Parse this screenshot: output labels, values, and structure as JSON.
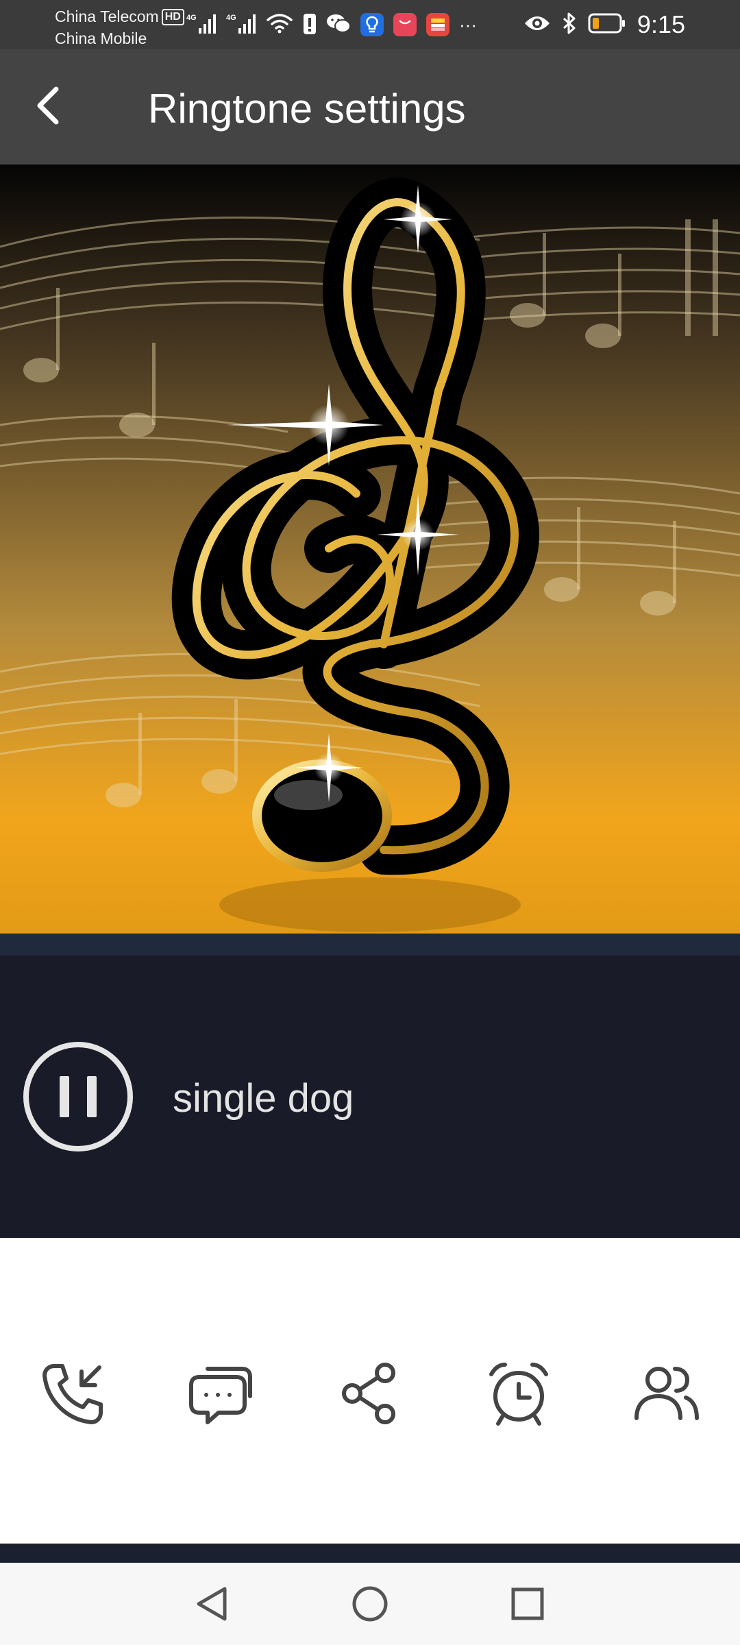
{
  "status_bar": {
    "carrier_1": "China Telecom",
    "carrier_1_badge": "HD",
    "carrier_2": "China Mobile",
    "network_1": "4G",
    "network_2": "4G",
    "more_indicator": "···",
    "time": "9:15",
    "battery_level": 0.2
  },
  "header": {
    "title": "Ringtone settings",
    "back_icon": "chevron-left-icon"
  },
  "player": {
    "state_icon": "pause-icon",
    "track_title": "single dog"
  },
  "actions": [
    {
      "icon": "incoming-call-icon"
    },
    {
      "icon": "message-icon"
    },
    {
      "icon": "share-icon"
    },
    {
      "icon": "alarm-clock-icon"
    },
    {
      "icon": "contacts-icon"
    }
  ],
  "nav_bar": {
    "back": "triangle-back-icon",
    "home": "circle-home-icon",
    "recents": "square-recents-icon"
  },
  "colors": {
    "header_bg": "#444444",
    "player_bg": "#191c28",
    "accent_gold": "#f2b01e"
  }
}
